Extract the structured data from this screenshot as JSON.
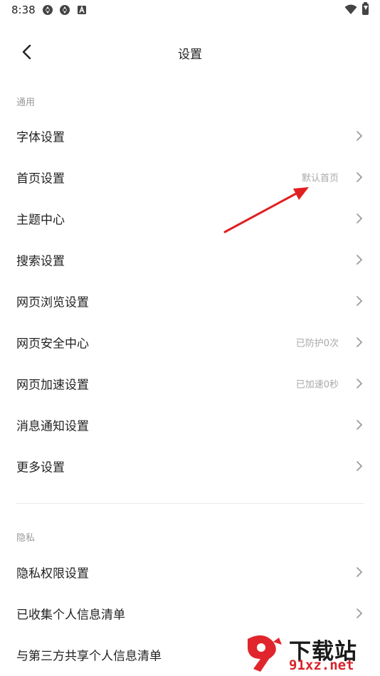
{
  "status_bar": {
    "time": "8:38",
    "icons": [
      "sync-icon",
      "sync-icon",
      "font-a-icon",
      "wifi-icon",
      "battery-charging-icon"
    ]
  },
  "header": {
    "back_icon": "chevron-left-icon",
    "title": "设置"
  },
  "sections": [
    {
      "label": "通用",
      "items": [
        {
          "label": "字体设置",
          "value": ""
        },
        {
          "label": "首页设置",
          "value": "默认首页"
        },
        {
          "label": "主题中心",
          "value": ""
        },
        {
          "label": "搜索设置",
          "value": ""
        },
        {
          "label": "网页浏览设置",
          "value": ""
        },
        {
          "label": "网页安全中心",
          "value": "已防护0次"
        },
        {
          "label": "网页加速设置",
          "value": "已加速0秒"
        },
        {
          "label": "消息通知设置",
          "value": ""
        },
        {
          "label": "更多设置",
          "value": ""
        }
      ]
    },
    {
      "label": "隐私",
      "items": [
        {
          "label": "隐私权限设置",
          "value": ""
        },
        {
          "label": "已收集个人信息清单",
          "value": ""
        },
        {
          "label": "与第三方共享个人信息清单",
          "value": ""
        }
      ]
    }
  ],
  "annotation": {
    "color": "#e02020"
  },
  "watermark": {
    "text": "下载站",
    "url": "91xz.net",
    "logo_color": "#e0262c"
  }
}
